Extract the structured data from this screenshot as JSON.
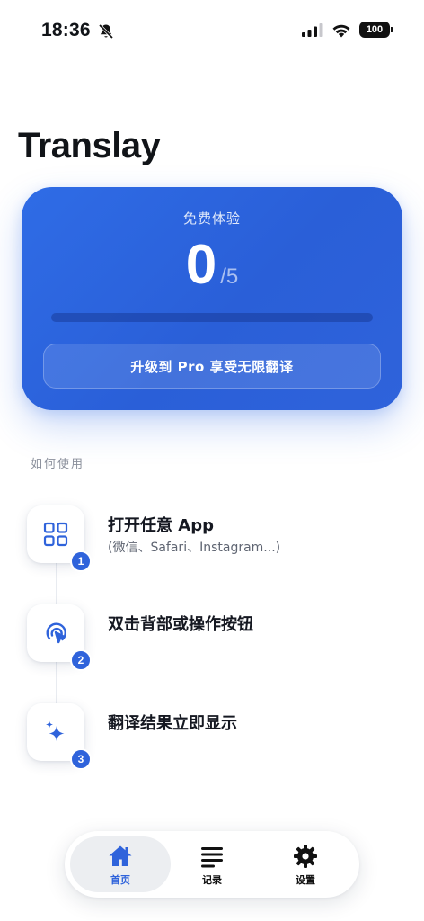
{
  "status_bar": {
    "time": "18:36",
    "battery": "100"
  },
  "app": {
    "title": "Translay"
  },
  "usage_card": {
    "label": "免费体验",
    "used": "0",
    "limit_text": "/5",
    "progress": 0,
    "upgrade_label": "升级到 Pro 享受无限翻译",
    "accent": "#2f63db"
  },
  "how_to": {
    "header": "如何使用",
    "steps": [
      {
        "number": "1",
        "title": "打开任意 App",
        "subtitle": "(微信、Safari、Instagram...)",
        "icon": "grid-icon"
      },
      {
        "number": "2",
        "title": "双击背部或操作按钮",
        "subtitle": "",
        "icon": "tap-icon"
      },
      {
        "number": "3",
        "title": "翻译结果立即显示",
        "subtitle": "",
        "icon": "sparkles-icon"
      }
    ]
  },
  "tab_bar": {
    "tabs": [
      {
        "label": "首页",
        "icon": "home-icon",
        "active": true
      },
      {
        "label": "记录",
        "icon": "list-icon",
        "active": false
      },
      {
        "label": "设置",
        "icon": "gear-icon",
        "active": false
      }
    ]
  }
}
